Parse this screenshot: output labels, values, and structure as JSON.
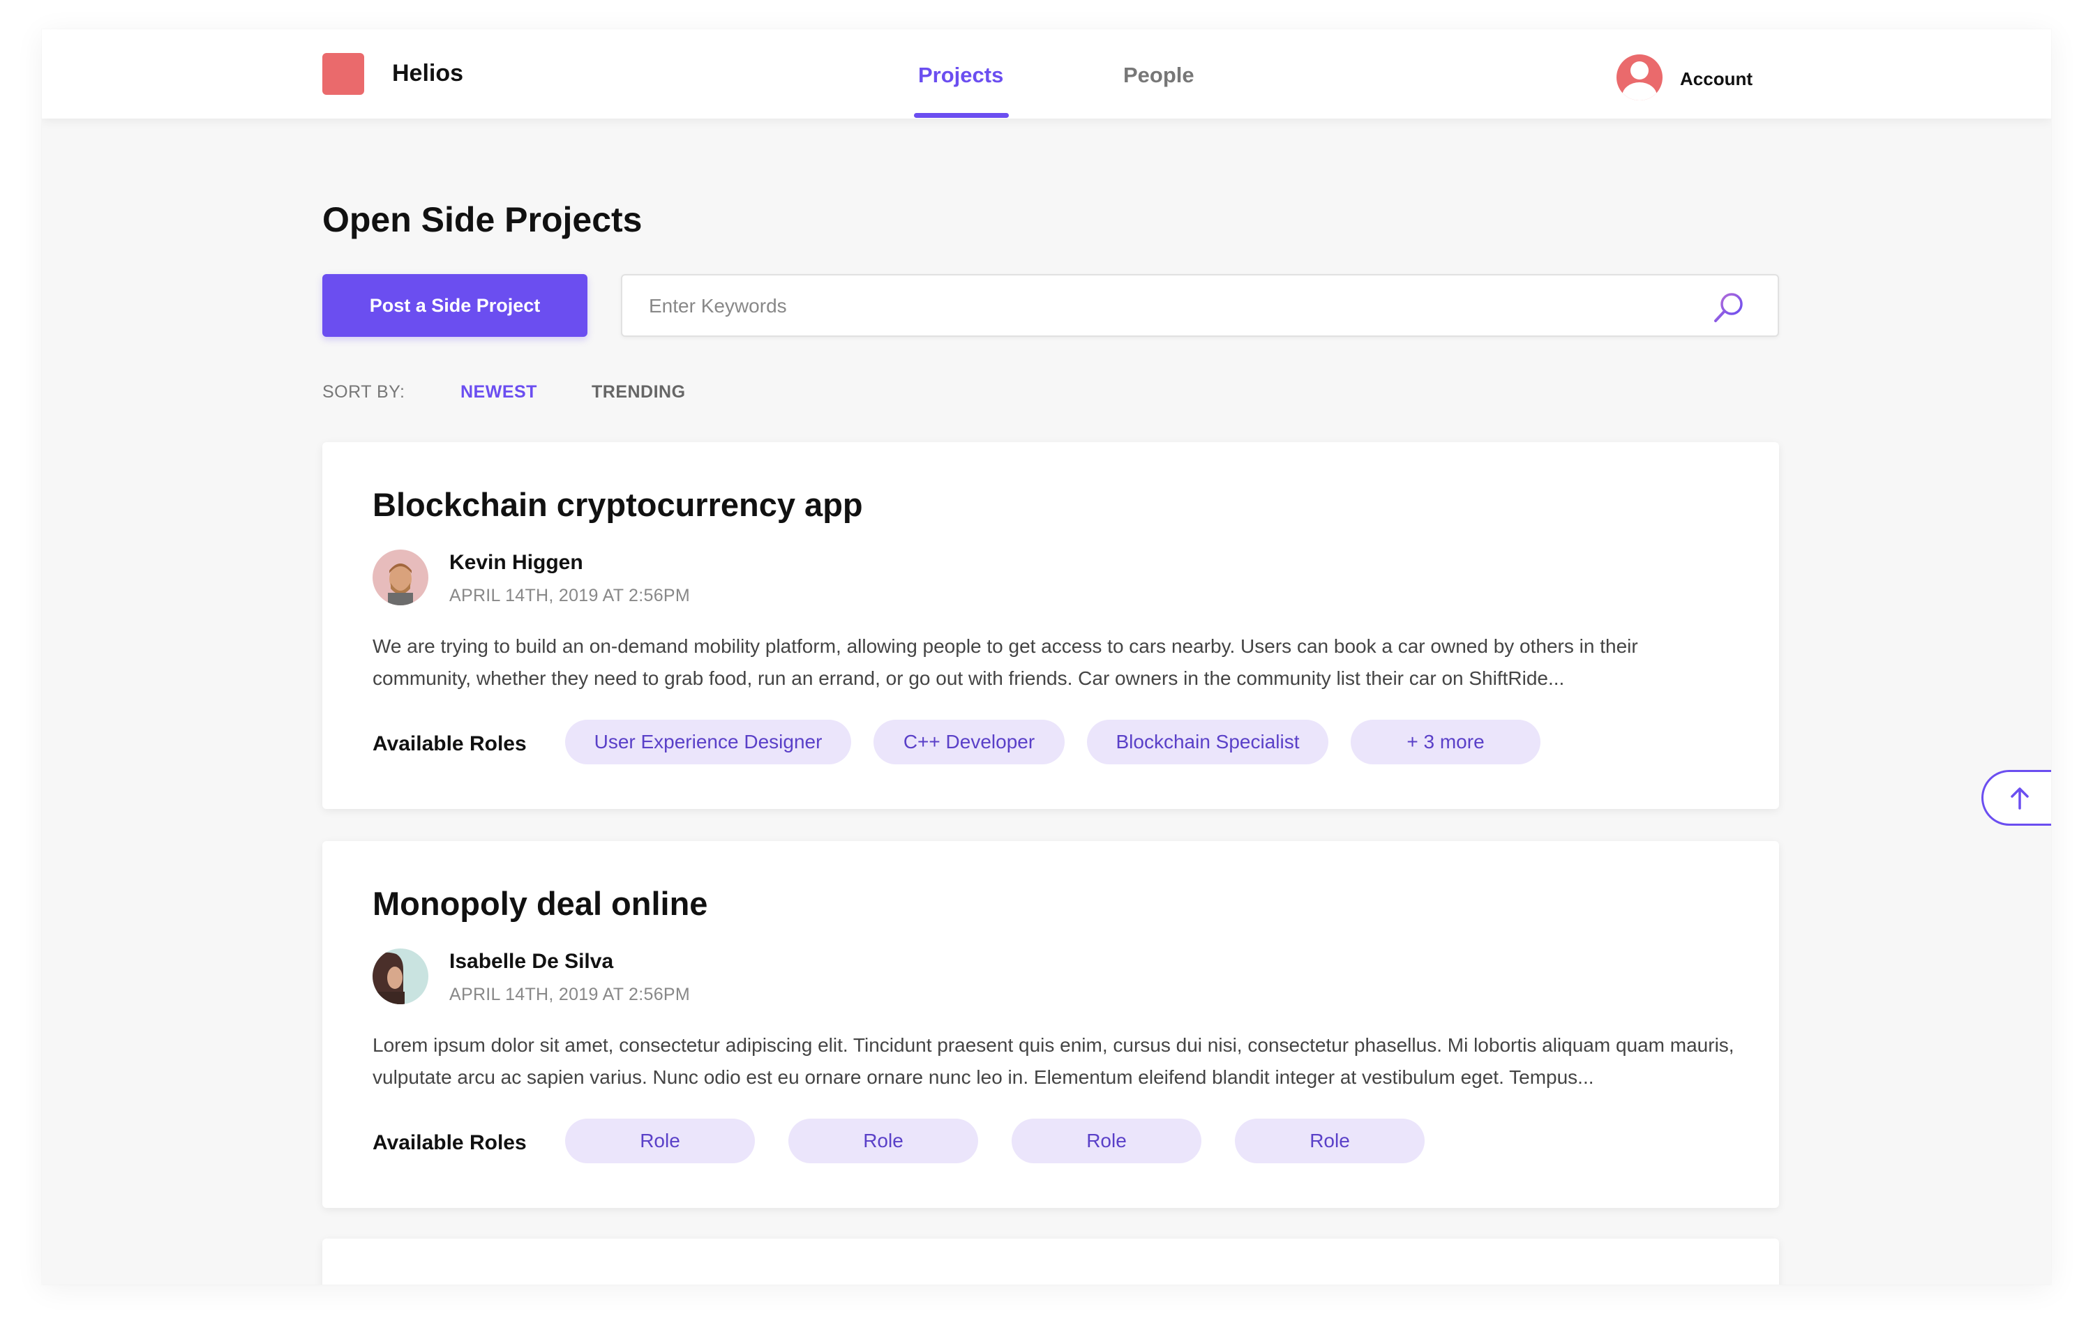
{
  "header": {
    "brand": "Helios",
    "tabs": [
      {
        "label": "Projects",
        "active": true
      },
      {
        "label": "People",
        "active": false
      }
    ],
    "account_label": "Account"
  },
  "main": {
    "title": "Open Side Projects",
    "post_button": "Post a Side Project",
    "search": {
      "placeholder": "Enter Keywords",
      "value": ""
    },
    "sort": {
      "label": "SORT BY:",
      "options": [
        {
          "label": "NEWEST",
          "active": true
        },
        {
          "label": "TRENDING",
          "active": false
        }
      ]
    },
    "roles_label": "Available Roles",
    "projects": [
      {
        "title": "Blockchain cryptocurrency app",
        "author": "Kevin Higgen",
        "date": "APRIL 14TH, 2019 AT 2:56PM",
        "description": "We are trying to build an on-demand mobility platform, allowing people to get access to cars nearby. Users can book a car owned by others in their community, whether they need to grab food, run an errand, or go out with friends. Car owners in the community list their car on ShiftRide...",
        "roles": [
          "User Experience Designer",
          "C++ Developer",
          "Blockchain Specialist",
          "+ 3 more"
        ]
      },
      {
        "title": "Monopoly deal online",
        "author": "Isabelle De Silva",
        "date": "APRIL 14TH, 2019 AT 2:56PM",
        "description": "Lorem ipsum dolor sit amet, consectetur adipiscing elit. Tincidunt praesent quis enim, cursus dui nisi, consectetur phasellus. Mi lobortis aliquam quam mauris, vulputate arcu ac sapien varius. Nunc odio est eu ornare ornare nunc leo in. Elementum eleifend blandit integer at vestibulum eget. Tempus...",
        "roles": [
          "Role",
          "Role",
          "Role",
          "Role"
        ]
      }
    ]
  },
  "icons": {
    "search": "search-icon",
    "account": "user-avatar-icon",
    "scroll_top": "arrow-up-icon"
  },
  "colors": {
    "accent": "#6b4ef0",
    "logo": "#ea6a6c",
    "pill_bg": "#ebe5fb",
    "pill_text": "#5a40c8"
  }
}
